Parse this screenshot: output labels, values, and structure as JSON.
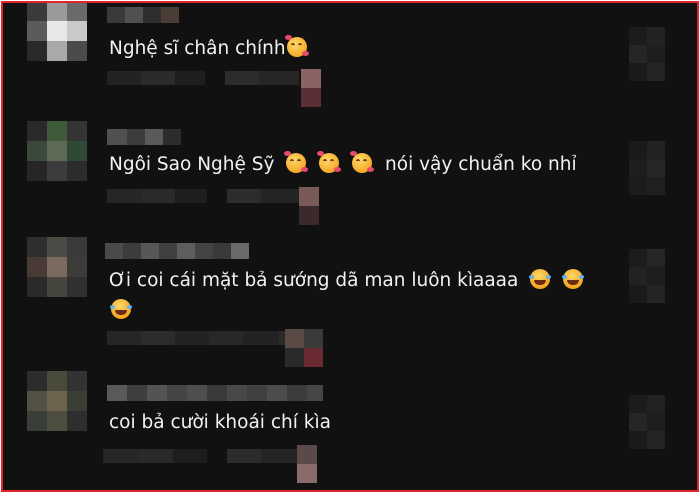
{
  "comments": [
    {
      "text": "Nghệ sĩ chân chính",
      "emojis_after": [
        "smiling-face-with-hearts"
      ],
      "avatar_colors": [
        "#3b3b3b",
        "#9a9a9a",
        "#6a6a6a",
        "#5b5b5b",
        "#e8e8e8",
        "#c9c9c9",
        "#2a2a2a",
        "#a9a9a9",
        "#4b4b4b"
      ],
      "reaction_colors": [
        "#8a6464",
        "#5a2e34"
      ]
    },
    {
      "text": "Ngôi Sao Nghệ Sỹ",
      "emojis_after": [
        "smiling-face-with-hearts",
        "smiling-face-with-hearts",
        "smiling-face-with-hearts"
      ],
      "text_after_emojis": "nói vậy chuẩn ko nhỉ",
      "avatar_colors": [
        "#2a2a2a",
        "#3f5a3a",
        "#343434",
        "#3a4a3a",
        "#5c6a56",
        "#2f4a34",
        "#262626",
        "#3c3c3c",
        "#2c2c2c"
      ],
      "reaction_colors": [
        "#7a5a58",
        "#3a2a2c"
      ]
    },
    {
      "text": "Ơi coi cái mặt bả sướng dã man luôn kìaaaa",
      "emojis_after": [
        "face-with-tears-of-joy",
        "face-with-tears-of-joy"
      ],
      "second_line_emojis": [
        "face-with-tears-of-joy"
      ],
      "avatar_colors": [
        "#2e2e2e",
        "#4c4a44",
        "#3a3a3a",
        "#4a3a36",
        "#7b6a5e",
        "#3c3c38",
        "#2a2a2a",
        "#46463e",
        "#303030"
      ],
      "reaction_colors": [
        "#5a4a44",
        "#6a2a32"
      ]
    },
    {
      "text": "coi bả cười khoái chí kìa",
      "avatar_colors": [
        "#2c2c2c",
        "#4a4a3a",
        "#333333",
        "#525244",
        "#6e644e",
        "#3a3e34",
        "#3a3e38",
        "#4e4e40",
        "#2e2e2e"
      ],
      "reaction_colors": [
        "#5a4a4a",
        "#8a6a6a"
      ]
    }
  ]
}
